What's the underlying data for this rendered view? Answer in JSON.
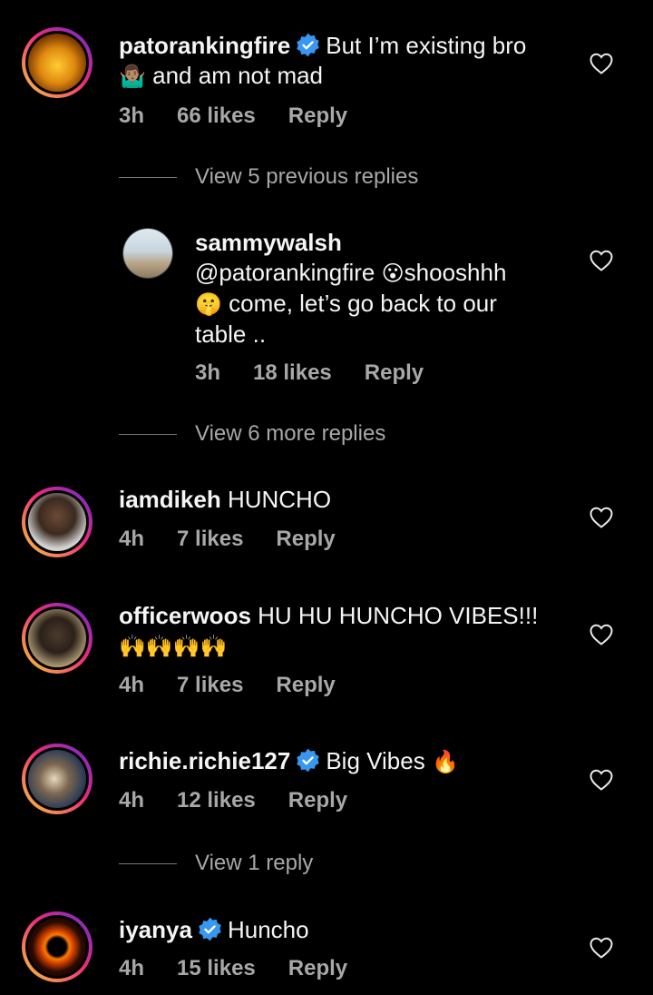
{
  "comments": [
    {
      "username": "patorankingfire",
      "verified": true,
      "text1": "But I’m existing bro",
      "emoji1": "🤷🏽‍♂️",
      "text2": "and am not mad",
      "time": "3h",
      "likes": "66 likes",
      "reply": "Reply"
    },
    {
      "username": "sammywalsh",
      "mention": "@patorankingfire",
      "emoji1": "😮",
      "text1": "shooshhh",
      "emoji2": "🤫",
      "text2": "come, let’s go back to our",
      "text3": "table ..",
      "time": "3h",
      "likes": "18 likes",
      "reply": "Reply"
    },
    {
      "username": "iamdikeh",
      "text1": "HUNCHO",
      "time": "4h",
      "likes": "7 likes",
      "reply": "Reply"
    },
    {
      "username": "officerwoos",
      "text1": "HU HU HUNCHO VIBES!!!",
      "emoji1": "🙌🙌🙌🙌",
      "time": "4h",
      "likes": "7 likes",
      "reply": "Reply"
    },
    {
      "username": "richie.richie127",
      "verified": true,
      "text1": "Big Vibes",
      "emoji1": "🔥",
      "time": "4h",
      "likes": "12 likes",
      "reply": "Reply"
    },
    {
      "username": "iyanya",
      "verified": true,
      "text1": "Huncho",
      "time": "4h",
      "likes": "15 likes",
      "reply": "Reply"
    }
  ],
  "view_links": {
    "previous": "View 5 previous replies",
    "more": "View 6 more replies",
    "one": "View 1 reply"
  },
  "colors": {
    "background": "#000000",
    "verified": "#3897f0",
    "secondary": "#a8a8a8"
  },
  "icons": {
    "like": "heart-outline-icon",
    "verified": "verified-badge-icon"
  }
}
